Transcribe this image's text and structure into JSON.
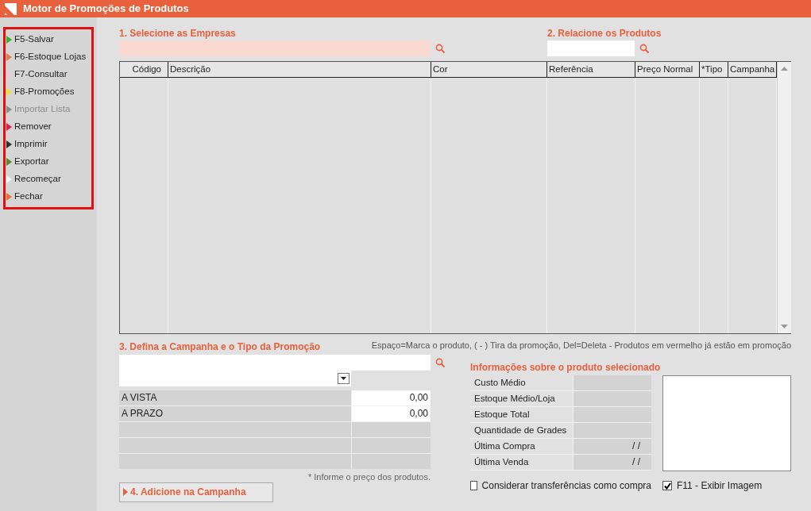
{
  "window": {
    "title": "Motor de Promoções de Produtos"
  },
  "sidebar": {
    "items": [
      {
        "label": "F5-Salvar",
        "color": "#2fb52f",
        "disabled": false
      },
      {
        "label": "F6-Estoque Lojas",
        "color": "#e0804a",
        "disabled": false
      },
      {
        "label": "F7-Consultar",
        "color": "#f2c6dc",
        "disabled": false
      },
      {
        "label": "F8-Promoções",
        "color": "#f2e030",
        "disabled": false
      },
      {
        "label": "Importar Lista",
        "color": "#8c8c8c",
        "disabled": true
      },
      {
        "label": "Remover",
        "color": "#e0204a",
        "disabled": false
      },
      {
        "label": "Imprimir",
        "color": "#303030",
        "disabled": false
      },
      {
        "label": "Exportar",
        "color": "#5a8a20",
        "disabled": false
      },
      {
        "label": "Recomeçar",
        "color": "#f4f4f4",
        "disabled": false
      },
      {
        "label": "Fechar",
        "color": "#f07030",
        "disabled": false
      }
    ]
  },
  "companies": {
    "label": "1. Selecione as Empresas"
  },
  "products": {
    "label": "2. Relacione os Produtos"
  },
  "table": {
    "columns": [
      "Código",
      "Descrição",
      "Cor",
      "Referência",
      "Preço Normal",
      "*Tipo",
      "Campanha"
    ]
  },
  "hint": "Espaço=Marca o produto, ( - ) Tira da promoção, Del=Deleta - Produtos em vermelho já estão em promoção",
  "campaign": {
    "label": "3. Defina a Campanha e o Tipo da Promoção",
    "prices": [
      {
        "label": "A VISTA",
        "value": "0,00"
      },
      {
        "label": "A PRAZO",
        "value": "0,00"
      }
    ],
    "note": "* Informe o preço dos produtos.",
    "button": "4. Adicione na Campanha"
  },
  "info": {
    "title": "Informações sobre o produto selecionado",
    "rows": [
      {
        "label": "Custo Médio"
      },
      {
        "label": "Estoque Médio/Loja"
      },
      {
        "label": "Estoque Total"
      },
      {
        "label": "Quantidade de Grades"
      },
      {
        "label": "Última Compra",
        "value": "/ /"
      },
      {
        "label": "Última Venda",
        "value": "/ /"
      }
    ]
  },
  "checkboxes": [
    {
      "label": "Considerar transferências como compra",
      "checked": false
    },
    {
      "label": "F11 - Exibir Imagem",
      "checked": true
    }
  ]
}
